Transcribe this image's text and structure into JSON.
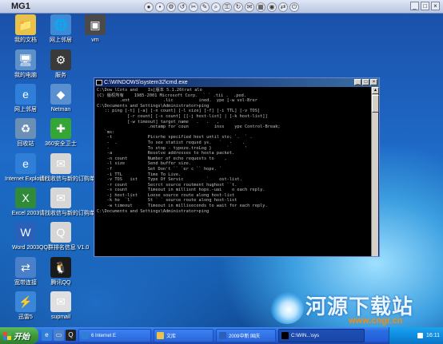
{
  "vm": {
    "title": "MG1",
    "toolbar_icons": [
      "circle-icon",
      "dot-icon",
      "gear-icon",
      "back-icon",
      "cut-icon",
      "edit-icon",
      "search-icon",
      "lock-icon",
      "refresh-icon",
      "chat-icon",
      "grid-icon",
      "eye-icon",
      "connect-icon",
      "power-icon"
    ],
    "toolbar_glyphs": [
      "●",
      "•",
      "⚙",
      "↺",
      "✂",
      "✎",
      "⌕",
      "⚿",
      "↻",
      "✉",
      "▦",
      "◉",
      "⇄",
      "⏻"
    ]
  },
  "desktop": {
    "icons": [
      {
        "name": "my-documents",
        "label": "我的文档",
        "glyph": "📁",
        "color": "#e8c24a"
      },
      {
        "name": "network-places",
        "label": "网上邻居",
        "glyph": "🌐",
        "color": "#3d8ad6"
      },
      {
        "name": "vmware",
        "label": "vm",
        "glyph": "▣",
        "color": "#4a4a4a"
      },
      {
        "name": "my-computer",
        "label": "我的电脑",
        "glyph": "🖥",
        "color": "#5d8fc9"
      },
      {
        "name": "qq-panel",
        "label": "服务",
        "glyph": "⚙",
        "color": "#3a3a3a"
      },
      {
        "name": "ie",
        "label": "网上邻居",
        "glyph": "e",
        "color": "#2f7ed8"
      },
      {
        "name": "netman",
        "label": "Netman",
        "glyph": "◆",
        "color": "#5a8fd0"
      },
      {
        "name": "recycle",
        "label": "回收站",
        "glyph": "♻",
        "color": "#6c8fb5"
      },
      {
        "name": "360-safe",
        "label": "360安全卫士",
        "glyph": "✚",
        "color": "#35a537"
      },
      {
        "name": "internet-explorer",
        "label": "Internet Explorer",
        "glyph": "e",
        "color": "#2f7ed8"
      },
      {
        "name": "rain-water",
        "label": "请找收信与新的订购单",
        "glyph": "✉",
        "color": "#d6d6d6"
      },
      {
        "name": "excel",
        "label": "Excel 2003",
        "glyph": "X",
        "color": "#2f8a3a"
      },
      {
        "name": "rain-order",
        "label": "请找收信与新的订购单",
        "glyph": "✉",
        "color": "#d6d6d6"
      },
      {
        "name": "word",
        "label": "Word 2003",
        "glyph": "W",
        "color": "#2a5fba"
      },
      {
        "name": "qq-agent",
        "label": "QQ群排名信息 V1.0",
        "glyph": "Q",
        "color": "#d6d6d6"
      },
      {
        "name": "broadband",
        "label": "宽带连接",
        "glyph": "⇄",
        "color": "#4a7fc9"
      },
      {
        "name": "tencent-qq",
        "label": "腾讯QQ",
        "glyph": "🐧",
        "color": "#1a1a1a"
      },
      {
        "name": "xunlei",
        "label": "迅雷5",
        "glyph": "⚡",
        "color": "#3a86d8"
      },
      {
        "name": "supmail",
        "label": "supmail",
        "glyph": "✉",
        "color": "#e0e0e0"
      }
    ]
  },
  "cmd": {
    "title": "C:\\WINDOWS\\system32\\cmd.exe",
    "lines": [
      "C:\\Dow lCots and    Is[版本 5.1.26trat alo",
      "(C) 版权所有    1985-2001 Microsoft Corp.  ` ` .tii .  .ped.",
      "         .ent             .lic          ined.  ype [-w vol-Brer",
      "C:\\Documents and Settings\\Administrator>ping",
      "",
      "   :: ping [-t] [-a] [-n count] [-l size] [-f] [-i TTL] [-v TOS]",
      "            [-r count] [-s count] [[-j host-list] | [-k host-list]]",
      "            [-w timeout] target_name   .   .   ,",
      "                    .netamp for coun          inss    ype Control-Break;",
      "",
      "   `ms:",
      "    -t              Picsrhe specified host until sto; `.  ` .",
      "    -  .            To see statist requsd ys.   `   -    .",
      "    -               To stop - typeze.troLog }      `      '",
      "    -a              Resolve addresses to hosta packet.",
      "    -n count        Number of echo requests to    ,",
      "    -l size         Send buffer size.",
      "    -f              Set Don't `` `er c `` hops. `",
      "    -i TTL          Time To Live.",
      "    -v TOS   ist    Type Of Servic         `    ost-list.",
      "    -r count        Secrct source routment hughost ``t.",
      "    -s count        Timeout in millisnt hops.-uai    o each reply.",
      "    -j host-list    Loose source route along host-list",
      "    -k ho  `l`      St ` ` source route along host-list",
      "    -w timeout      Timeout in milliseconds to wait for each reply.",
      "",
      "C:\\Documents and Settings\\Administrator>ping"
    ]
  },
  "watermark": {
    "text": "河源下载站",
    "url": "www.cngr.cn"
  },
  "taskbar": {
    "start_label": "开始",
    "quick_launch": [
      {
        "name": "ie",
        "glyph": "e",
        "color": "#2f7ed8"
      },
      {
        "name": "show-desktop",
        "glyph": "▭",
        "color": "#4a7fc9"
      },
      {
        "name": "qq",
        "glyph": "Q",
        "color": "#222"
      }
    ],
    "buttons": [
      {
        "name": "ie-window",
        "label": "6 Internet E",
        "color": "#2f7ed8",
        "active": false
      },
      {
        "name": "explorer-window",
        "label": "文库",
        "color": "#e8c24a",
        "active": false
      },
      {
        "name": "doc-window",
        "label": "2009中新 国庆",
        "color": "#2a5fba",
        "active": false
      },
      {
        "name": "cmd-window",
        "label": "C:\\WIN...\\sys",
        "color": "#000000",
        "active": true
      }
    ],
    "clock": "16:11"
  }
}
